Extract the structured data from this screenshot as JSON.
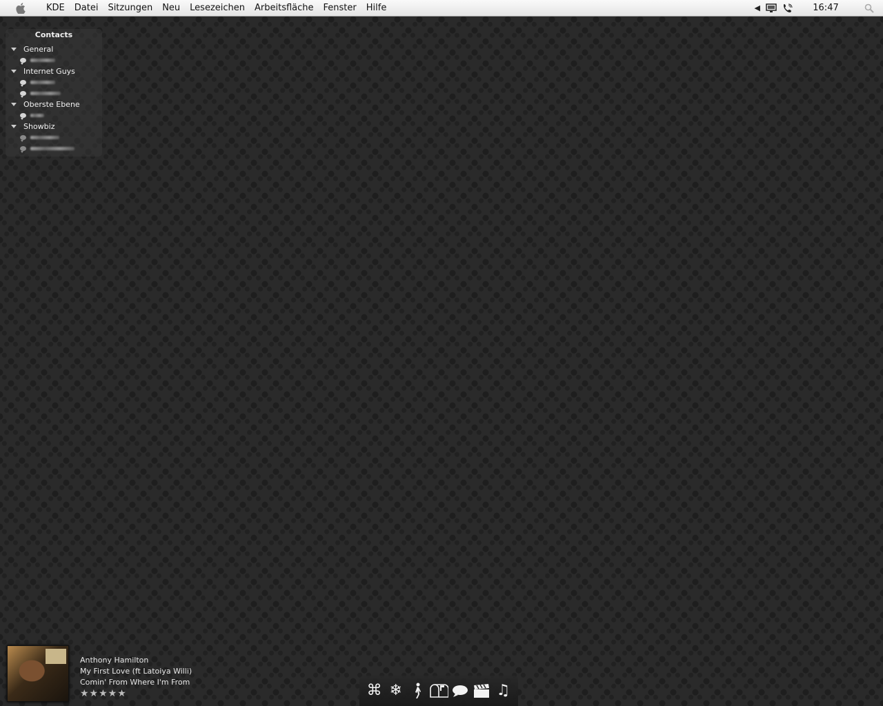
{
  "menubar": {
    "items": [
      "KDE",
      "Datei",
      "Sitzungen",
      "Neu",
      "Lesezeichen",
      "Arbeitsfläche",
      "Fenster",
      "Hilfe"
    ],
    "clock": "16:47",
    "tray_icons": [
      "arrow-left-icon",
      "monitor-icon",
      "phone-icon",
      "search-icon"
    ]
  },
  "contacts": {
    "title": "Contacts",
    "groups": [
      {
        "name": "General"
      },
      {
        "name": "Internet Guys"
      },
      {
        "name": "Oberste Ebene"
      },
      {
        "name": "Showbiz"
      }
    ]
  },
  "nowplaying": {
    "artist": "Anthony Hamilton",
    "track": "My First Love (ft Latoiya Willi)",
    "album": "Comin' From Where I'm From",
    "rating_stars": 5,
    "rating_display": "★★★★★"
  },
  "dock": {
    "icons": [
      "command-icon",
      "snowflake-icon",
      "figure-icon",
      "mailbox-icon",
      "chat-bubble-icon",
      "clapperboard-icon",
      "music-note-icon"
    ]
  }
}
